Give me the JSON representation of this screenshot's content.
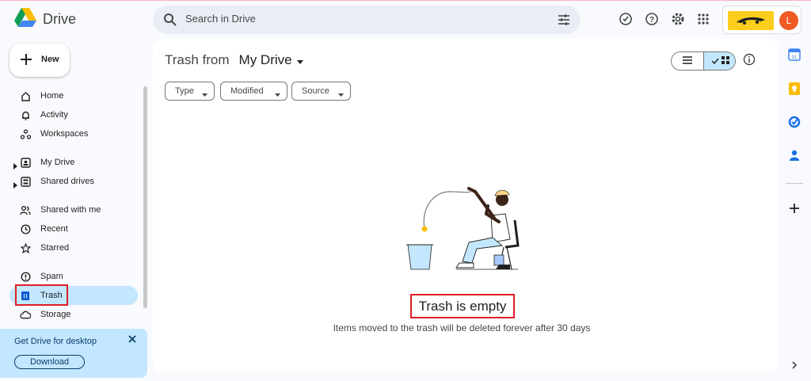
{
  "app": {
    "name": "Drive",
    "search_placeholder": "Search in Drive",
    "account_initial": "L"
  },
  "colors": {
    "accent": "#0b57d0",
    "active_nav": "#c2e7ff",
    "highlight_box": "#e01e26",
    "avatar": "#f05a22",
    "brand_badge": "#fbcd1d"
  },
  "header_icons": [
    "offline-status-icon",
    "help-icon",
    "settings-icon",
    "apps-grid-icon"
  ],
  "sidebar": {
    "new_label": "New",
    "items": [
      {
        "label": "Home",
        "icon": "home-icon"
      },
      {
        "label": "Activity",
        "icon": "bell-icon"
      },
      {
        "label": "Workspaces",
        "icon": "workspaces-icon"
      },
      {
        "label": "My Drive",
        "icon": "my-drive-icon"
      },
      {
        "label": "Shared drives",
        "icon": "shared-drives-icon"
      },
      {
        "label": "Shared with me",
        "icon": "people-icon"
      },
      {
        "label": "Recent",
        "icon": "clock-icon"
      },
      {
        "label": "Starred",
        "icon": "star-icon"
      },
      {
        "label": "Spam",
        "icon": "spam-icon"
      },
      {
        "label": "Trash",
        "icon": "trash-icon",
        "active": true
      },
      {
        "label": "Storage",
        "icon": "cloud-icon"
      }
    ]
  },
  "promo": {
    "title": "Get Drive for desktop",
    "button": "Download"
  },
  "main": {
    "title_prefix": "Trash from",
    "title_location": "My Drive",
    "filters": [
      "Type",
      "Modified",
      "Source"
    ],
    "empty_title": "Trash is empty",
    "empty_subtitle": "Items moved to the trash will be deleted forever after 30 days"
  },
  "right_rail_icons": [
    "calendar-icon",
    "keep-icon",
    "tasks-icon",
    "contacts-icon",
    "add-icon"
  ]
}
